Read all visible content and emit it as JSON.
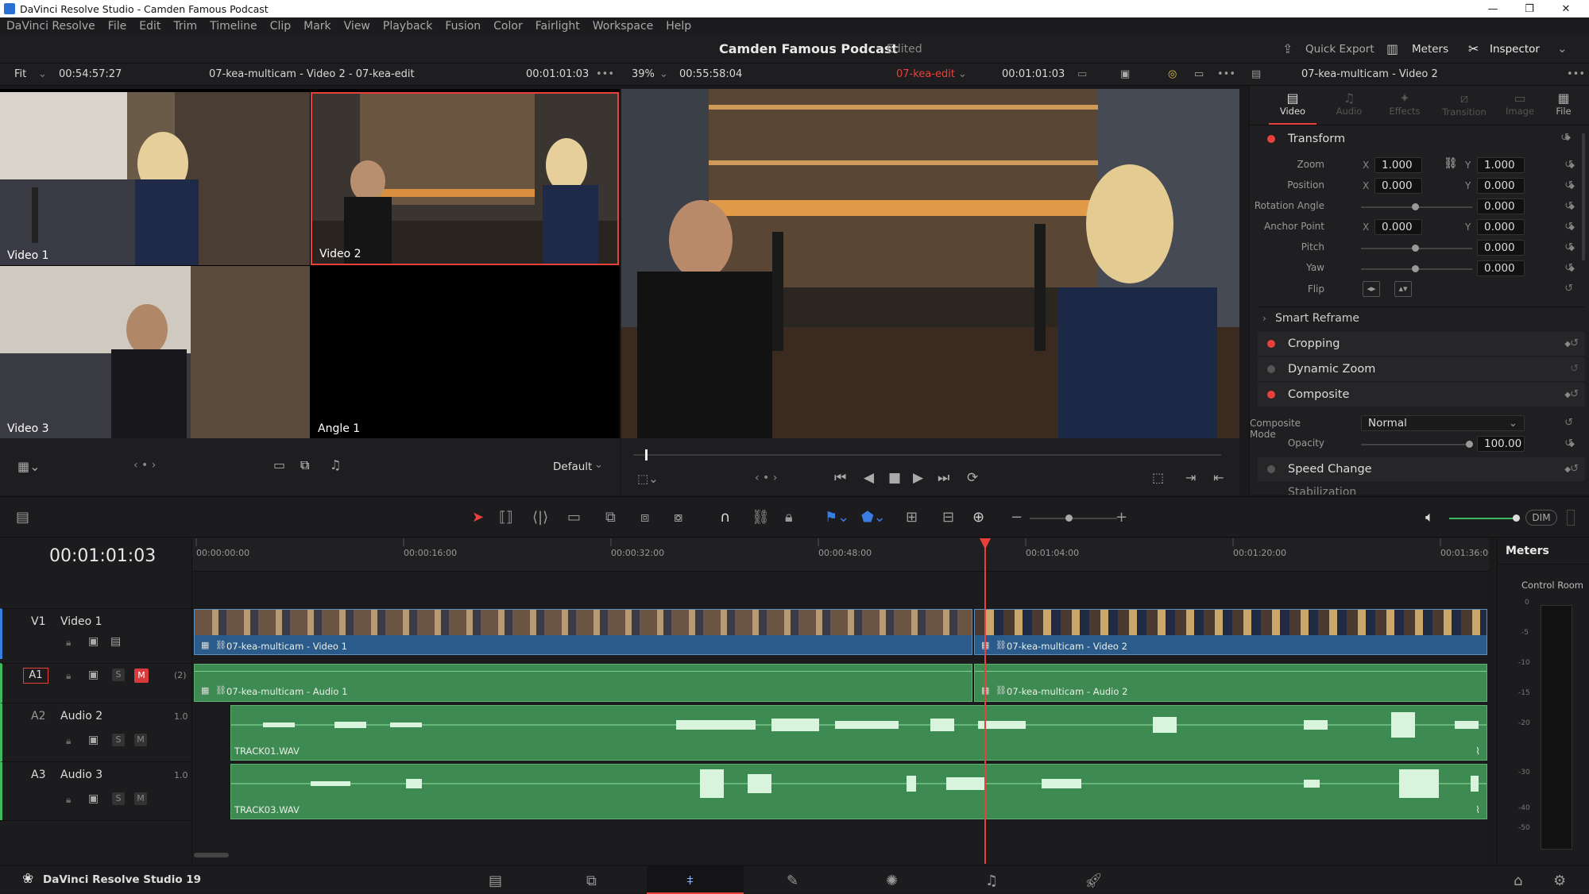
{
  "window": {
    "title": "DaVinci Resolve Studio - Camden Famous Podcast"
  },
  "menu": [
    "DaVinci Resolve",
    "File",
    "Edit",
    "Trim",
    "Timeline",
    "Clip",
    "Mark",
    "View",
    "Playback",
    "Fusion",
    "Color",
    "Fairlight",
    "Workspace",
    "Help"
  ],
  "header": {
    "project": "Camden Famous Podcast",
    "status": "Edited",
    "quick_export": "Quick Export",
    "meters": "Meters",
    "inspector": "Inspector"
  },
  "viewerbar": {
    "fit": "Fit",
    "src_tc": "00:54:57:27",
    "src_name": "07-kea-multicam - Video 2 - 07-kea-edit",
    "src_tc2": "00:01:01:03",
    "zoom": "39%",
    "rec_dur": "00:55:58:04",
    "timeline_name": "07-kea-edit",
    "rec_tc": "00:01:01:03",
    "ins_clip": "07-kea-multicam - Video 2"
  },
  "multicam": {
    "angles": [
      "Video 1",
      "Video 2",
      "Video 3",
      "Angle 1"
    ],
    "layout": "Default"
  },
  "inspector": {
    "tabs": [
      "Video",
      "Audio",
      "Effects",
      "Transition",
      "Image",
      "File"
    ],
    "transform": "Transform",
    "zoom_label": "Zoom",
    "zoom_x": "1.000",
    "zoom_y": "1.000",
    "pos_label": "Position",
    "pos_x": "0.000",
    "pos_y": "0.000",
    "rot_label": "Rotation Angle",
    "rot": "0.000",
    "anchor_label": "Anchor Point",
    "anchor_x": "0.000",
    "anchor_y": "0.000",
    "pitch_label": "Pitch",
    "pitch": "0.000",
    "yaw_label": "Yaw",
    "yaw": "0.000",
    "flip_label": "Flip",
    "x": "X",
    "y": "Y",
    "smart_reframe": "Smart Reframe",
    "cropping": "Cropping",
    "dynamic_zoom": "Dynamic Zoom",
    "composite": "Composite",
    "comp_mode_label": "Composite Mode",
    "comp_mode": "Normal",
    "opacity_label": "Opacity",
    "opacity": "100.00",
    "speed_change": "Speed Change",
    "stab": "Stabilization"
  },
  "timeline": {
    "timecode": "00:01:01:03",
    "ruler": [
      "00:00:00:00",
      "00:00:16:00",
      "00:00:32:00",
      "00:00:48:00",
      "00:01:04:00",
      "00:01:20:00",
      "00:01:36:00"
    ],
    "tracks": [
      {
        "id": "V1",
        "name": "Video 1"
      },
      {
        "id": "A1",
        "name": "",
        "ch": "(2)"
      },
      {
        "id": "A2",
        "name": "Audio 2",
        "ch": "1.0"
      },
      {
        "id": "A3",
        "name": "Audio 3",
        "ch": "1.0"
      }
    ],
    "clips": {
      "v1a": "07-kea-multicam - Video 1",
      "v1b": "07-kea-multicam - Video 2",
      "a1a": "07-kea-multicam - Audio 1",
      "a1b": "07-kea-multicam - Audio 2",
      "a2": "TRACK01.WAV",
      "a3": "TRACK03.WAV"
    },
    "s": "S",
    "m": "M",
    "dim": "DIM"
  },
  "meters": {
    "title": "Meters",
    "label": "Control Room",
    "scale": [
      "0",
      "-5",
      "-10",
      "-15",
      "-20",
      "-30",
      "-40",
      "-50"
    ]
  },
  "footer": {
    "app": "DaVinci Resolve Studio 19"
  },
  "colors": {
    "accent": "#e8413b",
    "video_clip": "#2b5b8a",
    "audio_clip": "#3d8a52",
    "playhead": "#e8413b"
  }
}
